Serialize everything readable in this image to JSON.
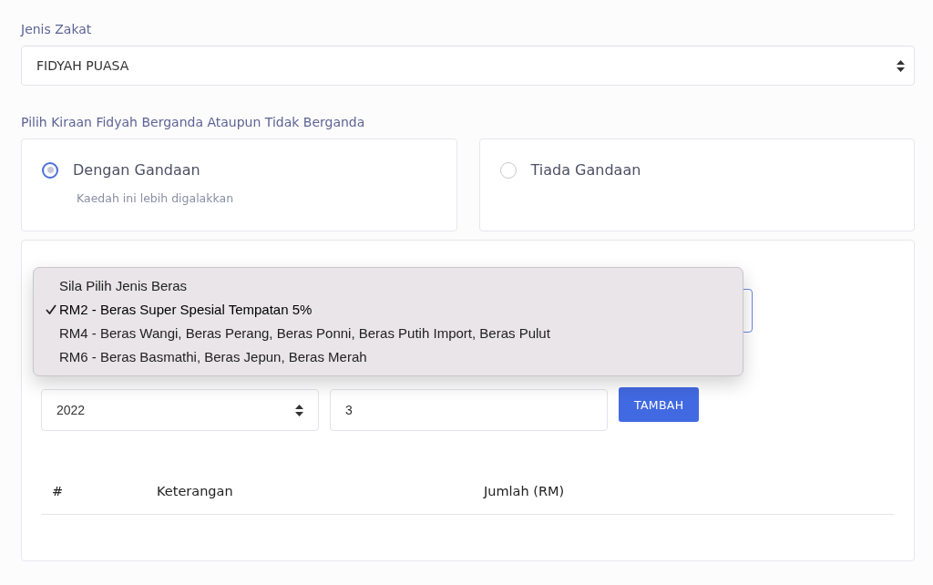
{
  "jenis_zakat": {
    "label": "Jenis Zakat",
    "value": "FIDYAH PUASA"
  },
  "kiraan": {
    "label": "Pilih Kiraan Fidyah Berganda Ataupun Tidak Berganda",
    "options": [
      {
        "title": "Dengan Gandaan",
        "description": "Kaedah ini lebih digalakkan",
        "selected": true
      },
      {
        "title": "Tiada Gandaan",
        "selected": false
      }
    ]
  },
  "rice_menu": {
    "options": [
      {
        "label": "Sila Pilih Jenis Beras",
        "selected": false
      },
      {
        "label": "RM2 - Beras Super Spesial Tempatan 5%",
        "selected": true
      },
      {
        "label": "RM4 - Beras Wangi, Beras Perang, Beras Ponni, Beras Putih Import, Beras Pulut",
        "selected": false
      },
      {
        "label": "RM6 - Beras Basmathi, Beras Jepun, Beras Merah",
        "selected": false
      }
    ]
  },
  "year_select": {
    "value": "2022"
  },
  "count_field": {
    "value": "3"
  },
  "add_button": "TAMBAH",
  "table": {
    "columns": [
      "#",
      "Keterangan",
      "Jumlah (RM)"
    ]
  }
}
